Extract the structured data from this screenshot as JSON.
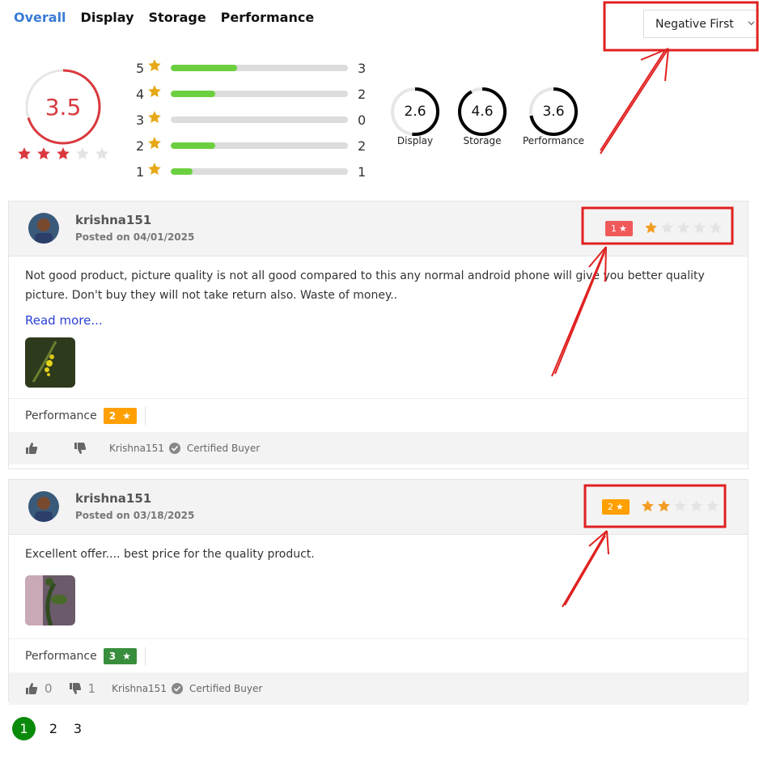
{
  "tabs": [
    {
      "label": "Overall",
      "active": true
    },
    {
      "label": "Display",
      "active": false
    },
    {
      "label": "Storage",
      "active": false
    },
    {
      "label": "Performance",
      "active": false
    }
  ],
  "sort": {
    "selected": "Negative First"
  },
  "summary": {
    "overall_rating": "3.5",
    "overall_stars": 3.5,
    "distribution": [
      {
        "stars": "5",
        "count": "3",
        "fraction": 0.375
      },
      {
        "stars": "4",
        "count": "2",
        "fraction": 0.25
      },
      {
        "stars": "3",
        "count": "0",
        "fraction": 0
      },
      {
        "stars": "2",
        "count": "2",
        "fraction": 0.25
      },
      {
        "stars": "1",
        "count": "1",
        "fraction": 0.125
      }
    ],
    "aspects": [
      {
        "label": "Display",
        "value": "2.6",
        "fraction": 0.52
      },
      {
        "label": "Storage",
        "value": "4.6",
        "fraction": 0.92
      },
      {
        "label": "Performance",
        "value": "3.6",
        "fraction": 0.72
      }
    ]
  },
  "reviews": [
    {
      "username": "krishna151",
      "posted": "Posted on 04/01/2025",
      "rating_badge": "1",
      "rating_stars": 1,
      "badge_color": "#f0595a",
      "text": "Not good product, picture quality is not all good compared to this any normal android phone will give you better quality picture. Don't buy they will not take return also. Waste of money..",
      "read_more": "Read more...",
      "aspect_label": "Performance",
      "aspect_rating": "2",
      "aspect_color": "#ff9f00",
      "likes": "",
      "dislikes": "",
      "buyer_name": "Krishna151",
      "certified": "Certified Buyer"
    },
    {
      "username": "krishna151",
      "posted": "Posted on 03/18/2025",
      "rating_badge": "2",
      "rating_stars": 2,
      "badge_color": "#ff9f00",
      "text": "Excellent offer.... best price for the quality product.",
      "aspect_label": "Performance",
      "aspect_rating": "3",
      "aspect_color": "#388e3c",
      "likes": "0",
      "dislikes": "1",
      "buyer_name": "Krishna151",
      "certified": "Certified Buyer"
    }
  ],
  "pagination": {
    "pages": [
      "1",
      "2",
      "3"
    ],
    "current": "1"
  },
  "colors": {
    "accent_tab": "#3a7bd5",
    "rating_red": "#d9393e",
    "bar_green": "#6ccf3f",
    "annotation_red": "#e02020",
    "star_gold": "#e6a817"
  }
}
